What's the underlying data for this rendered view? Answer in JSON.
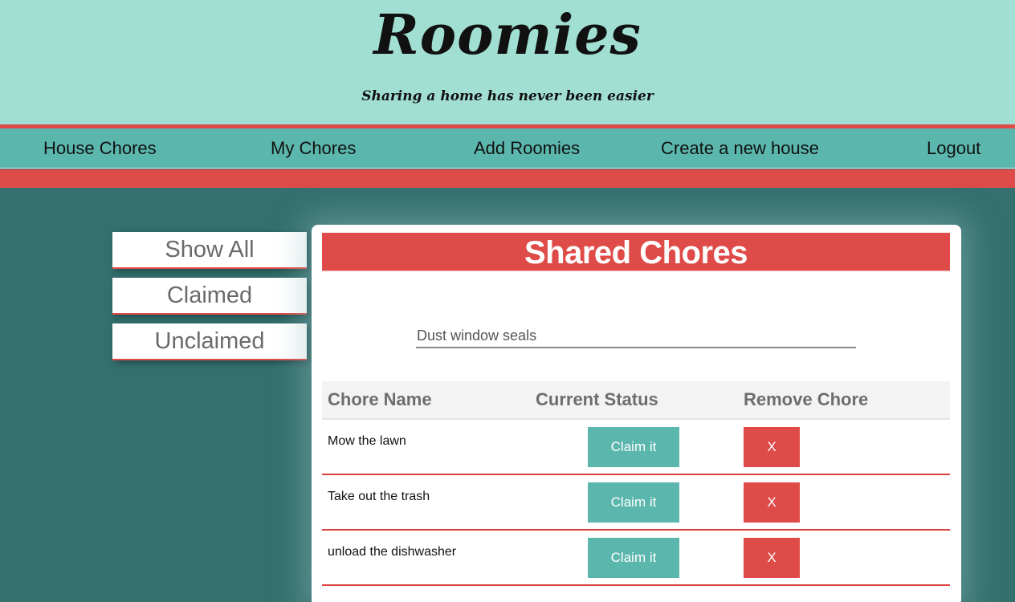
{
  "header": {
    "logo": "Roomies",
    "tagline": "Sharing a home has never been easier"
  },
  "nav": {
    "items": [
      {
        "label": "House Chores"
      },
      {
        "label": "My Chores"
      },
      {
        "label": "Add Roomies"
      },
      {
        "label": "Create a new house"
      },
      {
        "label": "Logout"
      }
    ]
  },
  "filters": {
    "show_all": "Show All",
    "claimed": "Claimed",
    "unclaimed": "Unclaimed"
  },
  "panel": {
    "title": "Shared Chores",
    "new_chore_value": "Dust window seals",
    "columns": [
      "Chore Name",
      "Current Status",
      "Remove Chore"
    ],
    "rows": [
      {
        "name": "Mow the lawn",
        "status_button": "Claim it",
        "remove_button": "X"
      },
      {
        "name": "Take out the trash",
        "status_button": "Claim it",
        "remove_button": "X"
      },
      {
        "name": "unload the dishwasher",
        "status_button": "Claim it",
        "remove_button": "X"
      }
    ]
  },
  "colors": {
    "header_bg": "#a1dfd2",
    "nav_bg": "#5bb7ad",
    "accent_red": "#de4b48",
    "page_bg": "#33706f"
  }
}
